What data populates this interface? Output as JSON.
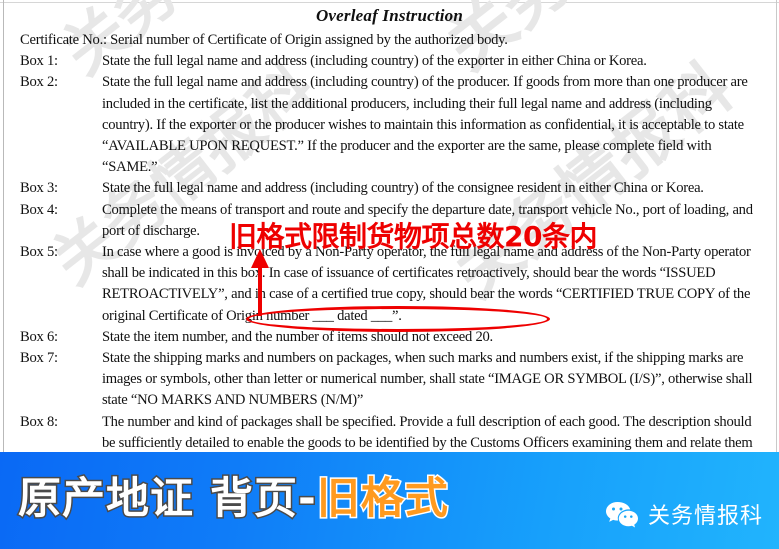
{
  "document": {
    "title": "Overleaf Instruction",
    "intro": {
      "label": "",
      "text": "Certificate No.: Serial number of Certificate of Origin assigned by the authorized body."
    },
    "entries": [
      {
        "label": "Box 1:",
        "text": "State the full legal name and address (including country) of the exporter in either China or Korea."
      },
      {
        "label": "Box 2:",
        "text": "State the full legal name and address (including country) of the producer.   If goods from more than one producer are included in the certificate, list the additional producers, including their full legal name and address (including country).   If the exporter or the producer wishes to maintain this information as confidential, it is acceptable to state “AVAILABLE UPON REQUEST.”   If the producer and the exporter are the same, please complete field with “SAME.”"
      },
      {
        "label": "Box 3:",
        "text": "State the full legal name and address (including country) of the consignee resident in either China or Korea."
      },
      {
        "label": "Box 4:",
        "text": "Complete the means of transport and route and specify the departure date, transport vehicle No., port of loading, and port of discharge."
      },
      {
        "label": "Box 5:",
        "text": "In case where a good is invoiced by a Non-Party operator, the full legal name and address of the Non-Party operator shall be indicated in this box.   In case of issuance of certificates retroactively, should bear the words “ISSUED RETROACTIVELY”, and in case of a certified true copy, should bear the words “CERTIFIED TRUE COPY of the original Certificate of Origin number ___ dated ___”."
      },
      {
        "label": "Box 6:",
        "text": "State the item number, and the number of items should not exceed 20."
      },
      {
        "label": "Box 7:",
        "text": "State the shipping marks and numbers on packages, when such marks and numbers exist, if the shipping marks are images or symbols, other than letter or numerical number, shall state “IMAGE OR SYMBOL (I/S)”, otherwise shall state “NO MARKS AND NUMBERS (N/M)”"
      },
      {
        "label": "Box 8:",
        "text": "The number and kind of packages shall be specified.   Provide a full description of each good.   The description should be sufficiently detailed to enable the goods to be identified by the Customs Officers examining them and relate them to the invoice description and to the HS description of the good.   If the"
      }
    ],
    "watermarks": [
      "关务情报科",
      "关务情报科",
      "关务情报科",
      "关务情报科"
    ]
  },
  "annotation": {
    "red_note": "旧格式限制货物项总数20条内",
    "highlight_color": "#ee0000",
    "arrow_icon": "up-arrow-icon",
    "oval_target_text": "and the number of items should not exceed 20."
  },
  "banner": {
    "title_white": "原产地证 背页-",
    "title_orange": "旧格式",
    "brand_name": "关务情报科",
    "brand_icon": "wechat-icon",
    "gradient_start": "#0a69f5",
    "gradient_end": "#21b4fd",
    "white_text_color": "#ffffff",
    "orange_text_color": "#ff9a1f"
  }
}
